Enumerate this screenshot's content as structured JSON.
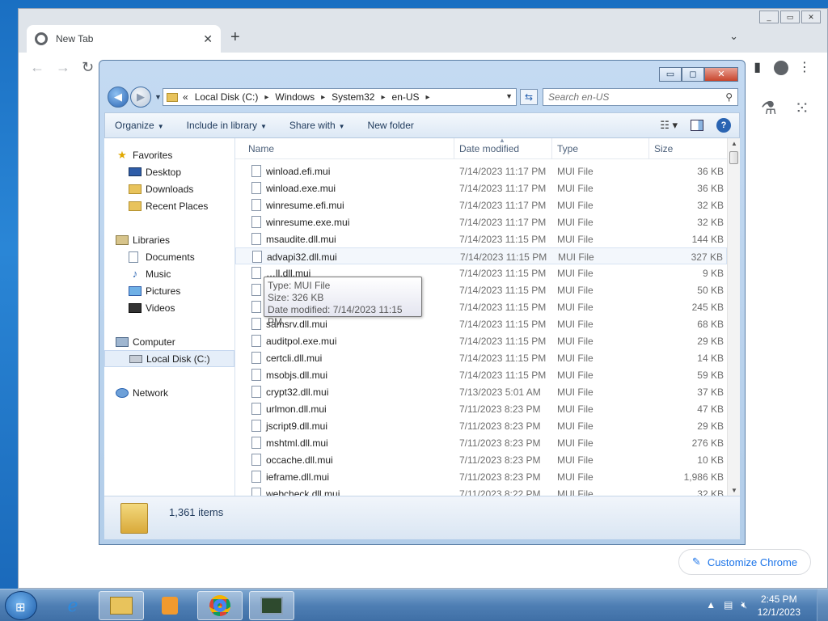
{
  "chrome": {
    "tab_title": "New Tab",
    "tab_close": "✕",
    "new_tab": "+",
    "tab_list": "⌄",
    "customize_label": "Customize Chrome",
    "customize_icon": "pencil-icon"
  },
  "explorer": {
    "window_controls": {
      "minimize": "▭",
      "maximize": "◻",
      "close": "✕"
    },
    "breadcrumb": {
      "overflow": "«",
      "items": [
        "Local Disk (C:)",
        "Windows",
        "System32",
        "en-US"
      ]
    },
    "search": {
      "placeholder": "Search en-US"
    },
    "commands": {
      "organize": "Organize",
      "include_in_library": "Include in library",
      "share_with": "Share with",
      "new_folder": "New folder"
    },
    "nav_pane": {
      "favorites": "Favorites",
      "desktop": "Desktop",
      "downloads": "Downloads",
      "recent_places": "Recent Places",
      "libraries": "Libraries",
      "documents": "Documents",
      "music": "Music",
      "pictures": "Pictures",
      "videos": "Videos",
      "computer": "Computer",
      "local_disk": "Local Disk (C:)",
      "network": "Network"
    },
    "columns": {
      "name": "Name",
      "date_modified": "Date modified",
      "type": "Type",
      "size": "Size"
    },
    "files": [
      {
        "name": "winload.efi.mui",
        "date": "7/14/2023 11:17 PM",
        "type": "MUI File",
        "size": "36 KB"
      },
      {
        "name": "winload.exe.mui",
        "date": "7/14/2023 11:17 PM",
        "type": "MUI File",
        "size": "36 KB"
      },
      {
        "name": "winresume.efi.mui",
        "date": "7/14/2023 11:17 PM",
        "type": "MUI File",
        "size": "32 KB"
      },
      {
        "name": "winresume.exe.mui",
        "date": "7/14/2023 11:17 PM",
        "type": "MUI File",
        "size": "32 KB"
      },
      {
        "name": "msaudite.dll.mui",
        "date": "7/14/2023 11:15 PM",
        "type": "MUI File",
        "size": "144 KB"
      },
      {
        "name": "advapi32.dll.mui",
        "date": "7/14/2023 11:15 PM",
        "type": "MUI File",
        "size": "327 KB"
      },
      {
        "name": "…ll.dll.mui",
        "date": "7/14/2023 11:15 PM",
        "type": "MUI File",
        "size": "9 KB"
      },
      {
        "name": "",
        "date": "7/14/2023 11:15 PM",
        "type": "MUI File",
        "size": "50 KB"
      },
      {
        "name": "",
        "date": "7/14/2023 11:15 PM",
        "type": "MUI File",
        "size": "245 KB"
      },
      {
        "name": "samsrv.dll.mui",
        "date": "7/14/2023 11:15 PM",
        "type": "MUI File",
        "size": "68 KB"
      },
      {
        "name": "auditpol.exe.mui",
        "date": "7/14/2023 11:15 PM",
        "type": "MUI File",
        "size": "29 KB"
      },
      {
        "name": "certcli.dll.mui",
        "date": "7/14/2023 11:15 PM",
        "type": "MUI File",
        "size": "14 KB"
      },
      {
        "name": "msobjs.dll.mui",
        "date": "7/14/2023 11:15 PM",
        "type": "MUI File",
        "size": "59 KB"
      },
      {
        "name": "crypt32.dll.mui",
        "date": "7/13/2023 5:01 AM",
        "type": "MUI File",
        "size": "37 KB"
      },
      {
        "name": "urlmon.dll.mui",
        "date": "7/11/2023 8:23 PM",
        "type": "MUI File",
        "size": "47 KB"
      },
      {
        "name": "jscript9.dll.mui",
        "date": "7/11/2023 8:23 PM",
        "type": "MUI File",
        "size": "29 KB"
      },
      {
        "name": "mshtml.dll.mui",
        "date": "7/11/2023 8:23 PM",
        "type": "MUI File",
        "size": "276 KB"
      },
      {
        "name": "occache.dll.mui",
        "date": "7/11/2023 8:23 PM",
        "type": "MUI File",
        "size": "10 KB"
      },
      {
        "name": "ieframe.dll.mui",
        "date": "7/11/2023 8:23 PM",
        "type": "MUI File",
        "size": "1,986 KB"
      },
      {
        "name": "webcheck.dll.mui",
        "date": "7/11/2023 8:22 PM",
        "type": "MUI File",
        "size": "32 KB"
      }
    ],
    "tooltip": {
      "type": "Type: MUI File",
      "size": "Size: 326 KB",
      "date": "Date modified: 7/14/2023 11:15 PM"
    },
    "details": {
      "item_count": "1,361 items"
    }
  },
  "taskbar": {
    "time": "2:45 PM",
    "date": "12/1/2023"
  }
}
